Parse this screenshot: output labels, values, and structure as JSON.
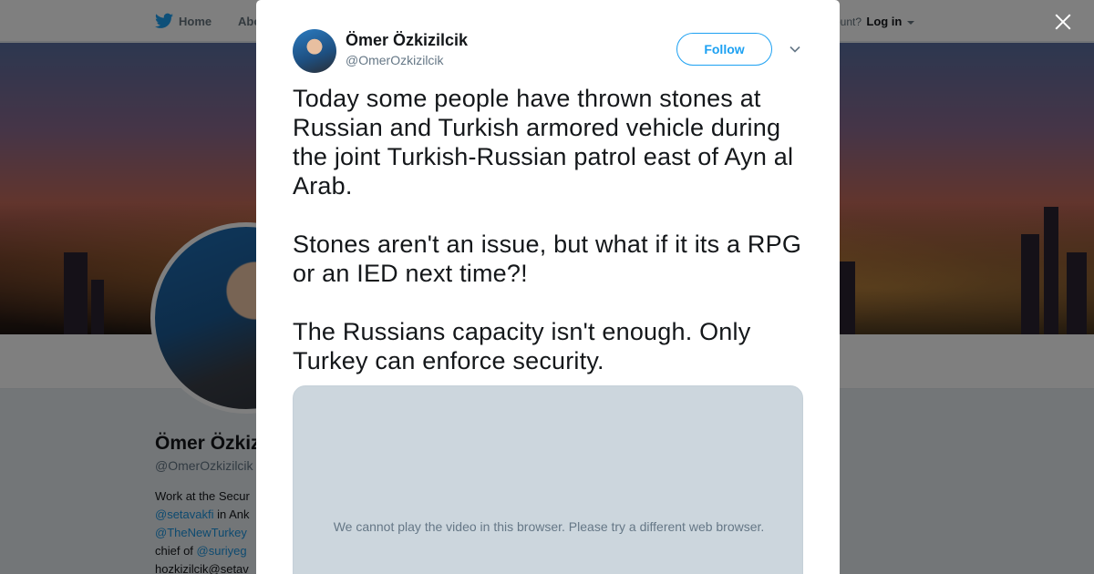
{
  "topnav": {
    "home_label": "Home",
    "about_label": "Abo",
    "account_prompt": "ccount?",
    "login_label": "Log in"
  },
  "profile": {
    "name": "Ömer Özkiz",
    "handle": "@OmerOzkizilcik",
    "bio_lines": [
      {
        "text": "Work at the Secur",
        "link": null
      },
      {
        "text": "@setavakfi",
        "link": true,
        "suffix": " in Ank"
      },
      {
        "text": "@TheNewTurkey",
        "link": true,
        "suffix": ""
      },
      {
        "prefix": "chief of ",
        "text": "@suriyeg",
        "link": true
      },
      {
        "text": "hozkizilcik@setav",
        "link": null
      }
    ]
  },
  "tweet": {
    "author_name": "Ömer Özkizilcik",
    "author_handle": "@OmerOzkizilcik",
    "follow_label": "Follow",
    "paragraphs": [
      "Today some people have thrown stones at Russian and Turkish armored vehicle during the joint Turkish-Russian patrol east of Ayn al Arab.",
      "Stones aren't an issue, but what if it its a RPG or an IED next time?!",
      "The Russians capacity isn't enough. Only Turkey can enforce security."
    ],
    "media_message": "We cannot play the video in this browser. Please try a different web browser."
  },
  "icons": {
    "brand": "twitter-bird-icon",
    "close": "close-icon",
    "more": "chevron-down-icon",
    "caret": "caret-down-icon"
  },
  "colors": {
    "twitter_blue": "#1da1f2",
    "link_blue": "#1b95e0",
    "text_dark": "#14171a",
    "text_muted": "#657786"
  }
}
